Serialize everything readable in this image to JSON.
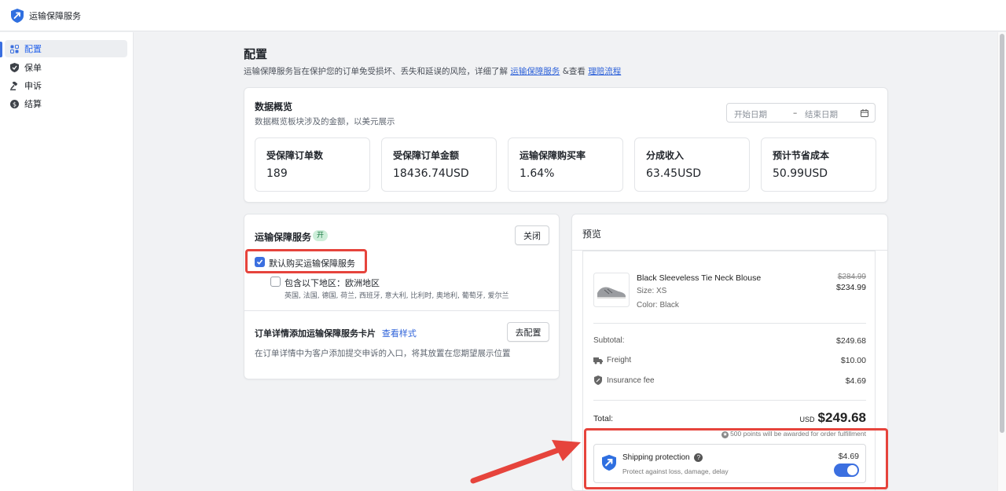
{
  "app": {
    "title": "运输保障服务"
  },
  "sidebar": {
    "items": [
      {
        "label": "配置",
        "icon": "settings-grid-icon",
        "active": true
      },
      {
        "label": "保单",
        "icon": "shield-icon"
      },
      {
        "label": "申诉",
        "icon": "gavel-icon"
      },
      {
        "label": "结算",
        "icon": "dollar-coin-icon"
      }
    ]
  },
  "page": {
    "title": "配置",
    "desc_prefix": "运输保障服务旨在保护您的订单免受损坏、丢失和延误的风险，详细了解",
    "link1": "运输保障服务",
    "desc_mid": "&查看",
    "link2": "理赔流程"
  },
  "overview": {
    "title": "数据概览",
    "subtitle": "数据概览板块涉及的金额，以美元展示",
    "start_placeholder": "开始日期",
    "end_placeholder": "结束日期",
    "stats": [
      {
        "label": "受保障订单数",
        "value": "189"
      },
      {
        "label": "受保障订单金额",
        "value": "18436.74USD"
      },
      {
        "label": "运输保障购买率",
        "value": "1.64%"
      },
      {
        "label": "分成收入",
        "value": "63.45USD"
      },
      {
        "label": "预计节省成本",
        "value": "50.99USD"
      }
    ]
  },
  "service": {
    "title": "运输保障服务",
    "status_badge": "开",
    "close_button": "关闭",
    "default_buy_label": "默认购买运输保障服务",
    "default_buy_checked": true,
    "region_label": "包含以下地区：欧洲地区",
    "region_checked": false,
    "region_countries": "英国, 法国, 德国, 荷兰, 西班牙, 意大利, 比利时, 奥地利, 葡萄牙, 爱尔兰",
    "card_title": "订单详情添加运输保障服务卡片",
    "card_link": "查看样式",
    "configure_button": "去配置",
    "card_desc": "在订单详情中为客户添加提交申诉的入口，将其放置在您期望展示位置"
  },
  "preview": {
    "title": "预览",
    "product": {
      "name": "Black Sleeveless Tie Neck Blouse",
      "size": "Size: XS",
      "color": "Color: Black",
      "original_price": "$284.99",
      "price": "$234.99"
    },
    "subtotal_label": "Subtotal:",
    "subtotal": "$249.68",
    "freight_label": "Freight",
    "freight": "$10.00",
    "insurance_label": "Insurance fee",
    "insurance": "$4.69",
    "total_label": "Total:",
    "total_currency": "USD",
    "total": "$249.68",
    "points_note": "500 points will be awarded for order fulfillment",
    "protection": {
      "title": "Shipping protection",
      "desc": "Protect against loss, damage, delay",
      "price": "$4.69",
      "enabled": true
    }
  },
  "colors": {
    "accent": "#3b6fe0",
    "highlight": "#e6443c",
    "badge_bg": "#cdeed9"
  }
}
